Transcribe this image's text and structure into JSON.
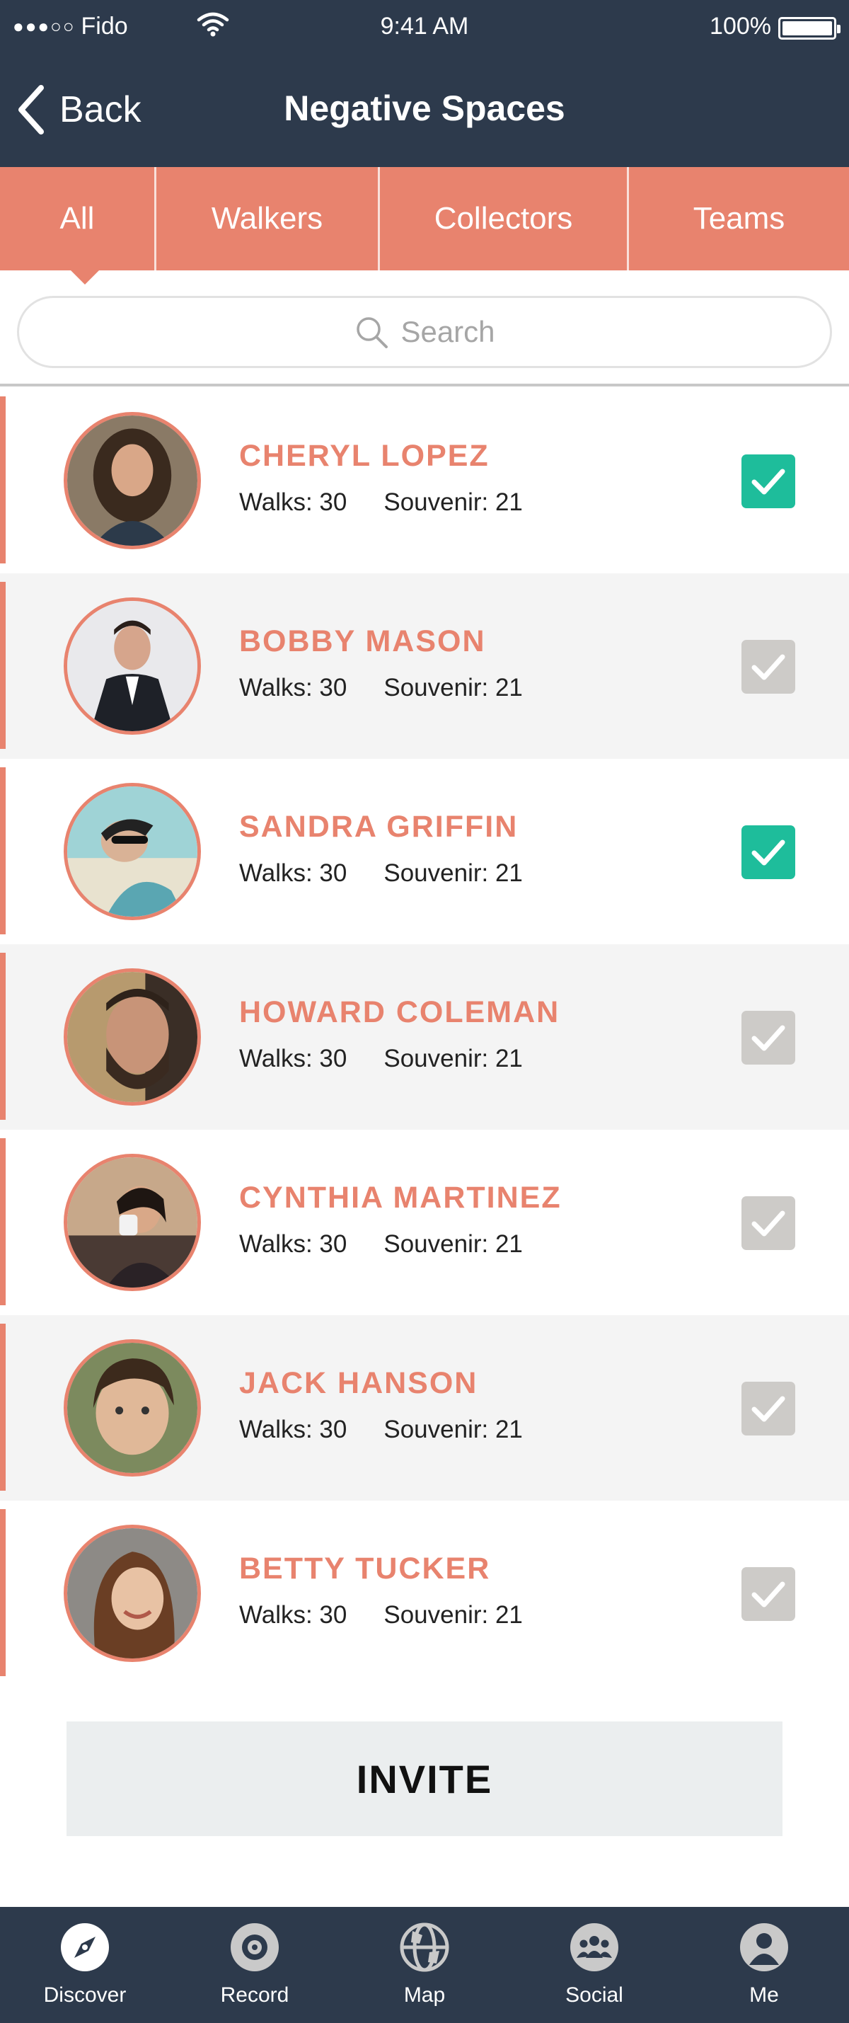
{
  "status_bar": {
    "signal": "●●●○○",
    "carrier": "Fido",
    "time": "9:41 AM",
    "battery": "100%"
  },
  "nav": {
    "back_label": "Back",
    "title": "Negative Spaces"
  },
  "tabs": [
    {
      "label": "All",
      "selected": true
    },
    {
      "label": "Walkers",
      "selected": false
    },
    {
      "label": "Collectors",
      "selected": false
    },
    {
      "label": "Teams",
      "selected": false
    }
  ],
  "search": {
    "placeholder": "Search"
  },
  "people": [
    {
      "name": "CHERYL LOPEZ",
      "walks": "Walks: 30",
      "souvenir": "Souvenir: 21",
      "checked": true
    },
    {
      "name": "BOBBY MASON",
      "walks": "Walks: 30",
      "souvenir": "Souvenir: 21",
      "checked": false
    },
    {
      "name": "SANDRA GRIFFIN",
      "walks": "Walks: 30",
      "souvenir": "Souvenir: 21",
      "checked": true
    },
    {
      "name": "HOWARD COLEMAN",
      "walks": "Walks: 30",
      "souvenir": "Souvenir: 21",
      "checked": false
    },
    {
      "name": "CYNTHIA MARTINEZ",
      "walks": "Walks: 30",
      "souvenir": "Souvenir: 21",
      "checked": false
    },
    {
      "name": "JACK HANSON",
      "walks": "Walks: 30",
      "souvenir": "Souvenir: 21",
      "checked": false
    },
    {
      "name": "BETTY TUCKER",
      "walks": "Walks: 30",
      "souvenir": "Souvenir: 21",
      "checked": false
    }
  ],
  "invite_label": "INVITE",
  "tabbar": [
    {
      "label": "Discover",
      "icon": "compass-icon"
    },
    {
      "label": "Record",
      "icon": "record-icon"
    },
    {
      "label": "Map",
      "icon": "globe-icon"
    },
    {
      "label": "Social",
      "icon": "group-icon"
    },
    {
      "label": "Me",
      "icon": "person-icon"
    }
  ],
  "colors": {
    "navy": "#2d3a4c",
    "coral": "#e8836e",
    "check_on": "#1ebd9b",
    "check_off": "#cdcbc8"
  }
}
